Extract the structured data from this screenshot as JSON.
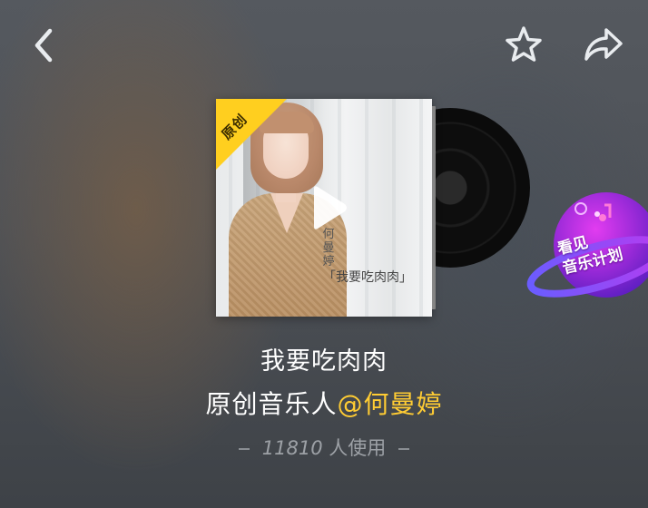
{
  "header": {
    "back_icon": "chevron-left-icon",
    "favorite_icon": "star-outline-icon",
    "share_icon": "share-arrow-icon"
  },
  "cover": {
    "badge_label": "原创",
    "artist_vertical": "何曼婷",
    "song_label": "「我要吃肉肉」",
    "play_icon": "play-icon",
    "badge_color": "#ffcf1f"
  },
  "promo": {
    "text": "看见\n音乐计划",
    "icon": "planet-icon"
  },
  "info": {
    "song_title": "我要吃肉肉",
    "artist_prefix": "原创音乐人",
    "artist_name": "@何曼婷",
    "usage_count": "11810",
    "usage_suffix": "人使用",
    "accent_color": "#ffcc33"
  }
}
